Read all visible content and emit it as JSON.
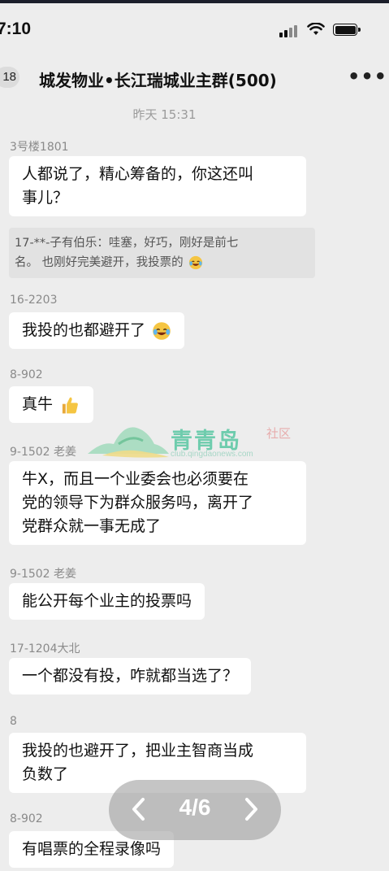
{
  "status_bar": {
    "time": "7:10"
  },
  "header": {
    "unread_count": "18",
    "title": "城发物业•长江瑞城业主群(500)",
    "more_label": "•••"
  },
  "chat": {
    "timestamp": "昨天 15:31",
    "messages": [
      {
        "sender": "3号楼1801",
        "lines": [
          "人都说了，精心筹备的，你这还叫",
          "事儿？"
        ],
        "quote_lines": [
          "17-**-子有伯乐：哇塞，好巧，刚好是前七",
          "名。 也刚好完美避开，我投票的"
        ],
        "quote_emoji": "laughing-crying-emoji"
      },
      {
        "sender": "16-2203",
        "lines": [
          "我投的也都避开了"
        ],
        "emoji": "laughing-crying-emoji"
      },
      {
        "sender": "8-902",
        "lines": [
          "真牛"
        ],
        "emoji": "thumbs-up-emoji"
      },
      {
        "sender": "9-1502  老姜",
        "lines": [
          "牛X，而且一个业委会也必须要在",
          "党的领导下为群众服务吗，离开了",
          "党群众就一事无成了"
        ]
      },
      {
        "sender": "9-1502  老姜",
        "lines": [
          "能公开每个业主的投票吗"
        ]
      },
      {
        "sender": "17-1204大北",
        "lines": [
          "一个都没有投，咋就都当选了？"
        ]
      },
      {
        "sender": "8",
        "lines": [
          "我投的也避开了，把业主智商当成",
          "负数了"
        ]
      },
      {
        "sender": "8-902",
        "lines": [
          "有唱票的全程录像吗"
        ]
      }
    ]
  },
  "watermark": {
    "title": "青青岛",
    "tag": "社区",
    "url": "club.qingdaonews.com"
  },
  "pager": {
    "counter": "4/6"
  },
  "colors": {
    "bubble": "#ffffff",
    "background": "#ededed",
    "quote_bg": "#e2e2e2",
    "watermark_green": "#58c7a3"
  }
}
